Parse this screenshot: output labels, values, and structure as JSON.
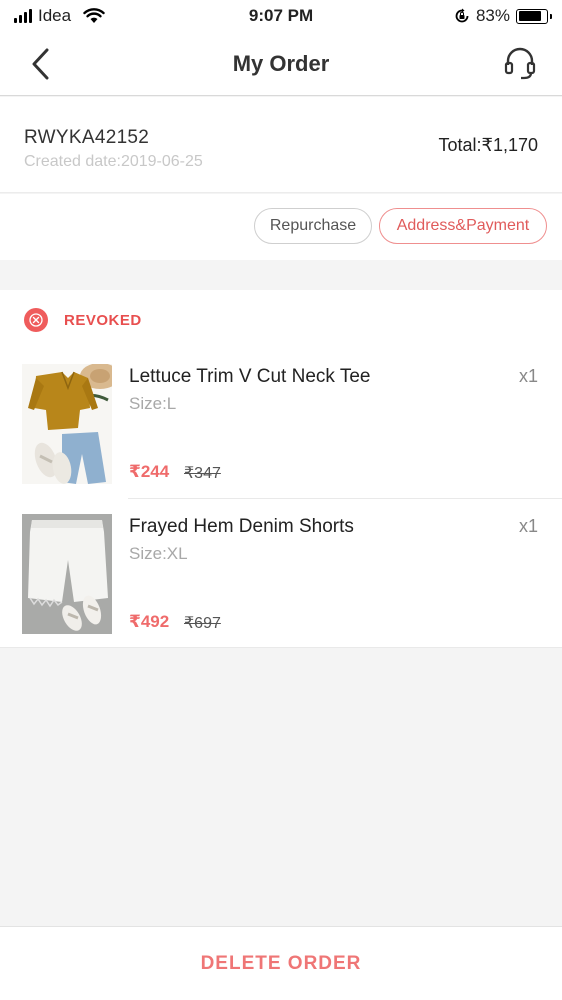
{
  "status_bar": {
    "carrier": "Idea",
    "time": "9:07 PM",
    "battery": "83%"
  },
  "nav": {
    "title": "My Order",
    "back_icon": "chevron-left-icon",
    "support_icon": "headset-icon"
  },
  "order": {
    "id": "RWYKA42152",
    "created": "Created date:2019-06-25",
    "total": "Total:₹1,170"
  },
  "actions": {
    "repurchase": "Repurchase",
    "address_payment": "Address&Payment"
  },
  "status": {
    "label": "REVOKED",
    "icon": "close-circle-icon",
    "color": "#ef5c5c"
  },
  "items": [
    {
      "name": "Lettuce Trim V Cut Neck Tee",
      "size": "Size:L",
      "price": "₹244",
      "original": "₹347",
      "qty": "x1"
    },
    {
      "name": "Frayed Hem Denim Shorts",
      "size": "Size:XL",
      "price": "₹492",
      "original": "₹697",
      "qty": "x1"
    }
  ],
  "bottom": {
    "delete": "DELETE ORDER"
  },
  "colors": {
    "accent": "#ef6b6b",
    "muted": "#a8a8a8"
  }
}
